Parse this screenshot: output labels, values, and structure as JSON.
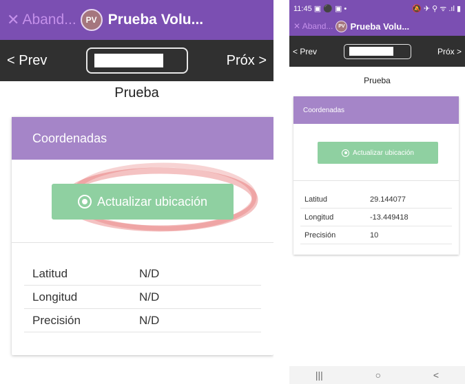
{
  "left": {
    "abandon_icon": "✕",
    "abandon_label": "Aband...",
    "avatar_initials": "PV",
    "title": "Prueba Volu...",
    "prev_label": "< Prev",
    "next_label": "Próx >",
    "form_title": "Prueba",
    "card_title": "Coordenadas",
    "update_button": "Actualizar ubicación",
    "rows": [
      {
        "label": "Latitud",
        "value": "N/D"
      },
      {
        "label": "Longitud",
        "value": "N/D"
      },
      {
        "label": "Precisión",
        "value": "N/D"
      }
    ]
  },
  "right": {
    "status_time": "11:45",
    "status_left_icons": "▣ ⚫ ▣ •",
    "status_right_icons": "🔕 ✈ ⚲ ᯤ .ıl ▮",
    "abandon_label": "✕ Aband...",
    "avatar_initials": "PV",
    "title": "Prueba Volu...",
    "prev_label": "< Prev",
    "next_label": "Próx >",
    "form_title": "Prueba",
    "card_title": "Coordenadas",
    "update_button": "Actualizar ubicación",
    "rows": [
      {
        "label": "Latitud",
        "value": "29.144077"
      },
      {
        "label": "Longitud",
        "value": "-13.449418"
      },
      {
        "label": "Precisión",
        "value": "10"
      }
    ],
    "nav_recent": "|||",
    "nav_home": "○",
    "nav_back": "<"
  },
  "colors": {
    "appbar": "#7b4fb2",
    "navbar": "#303030",
    "card_header": "#a585c8",
    "button": "#8fd0a1",
    "scribble": "#e05050"
  }
}
